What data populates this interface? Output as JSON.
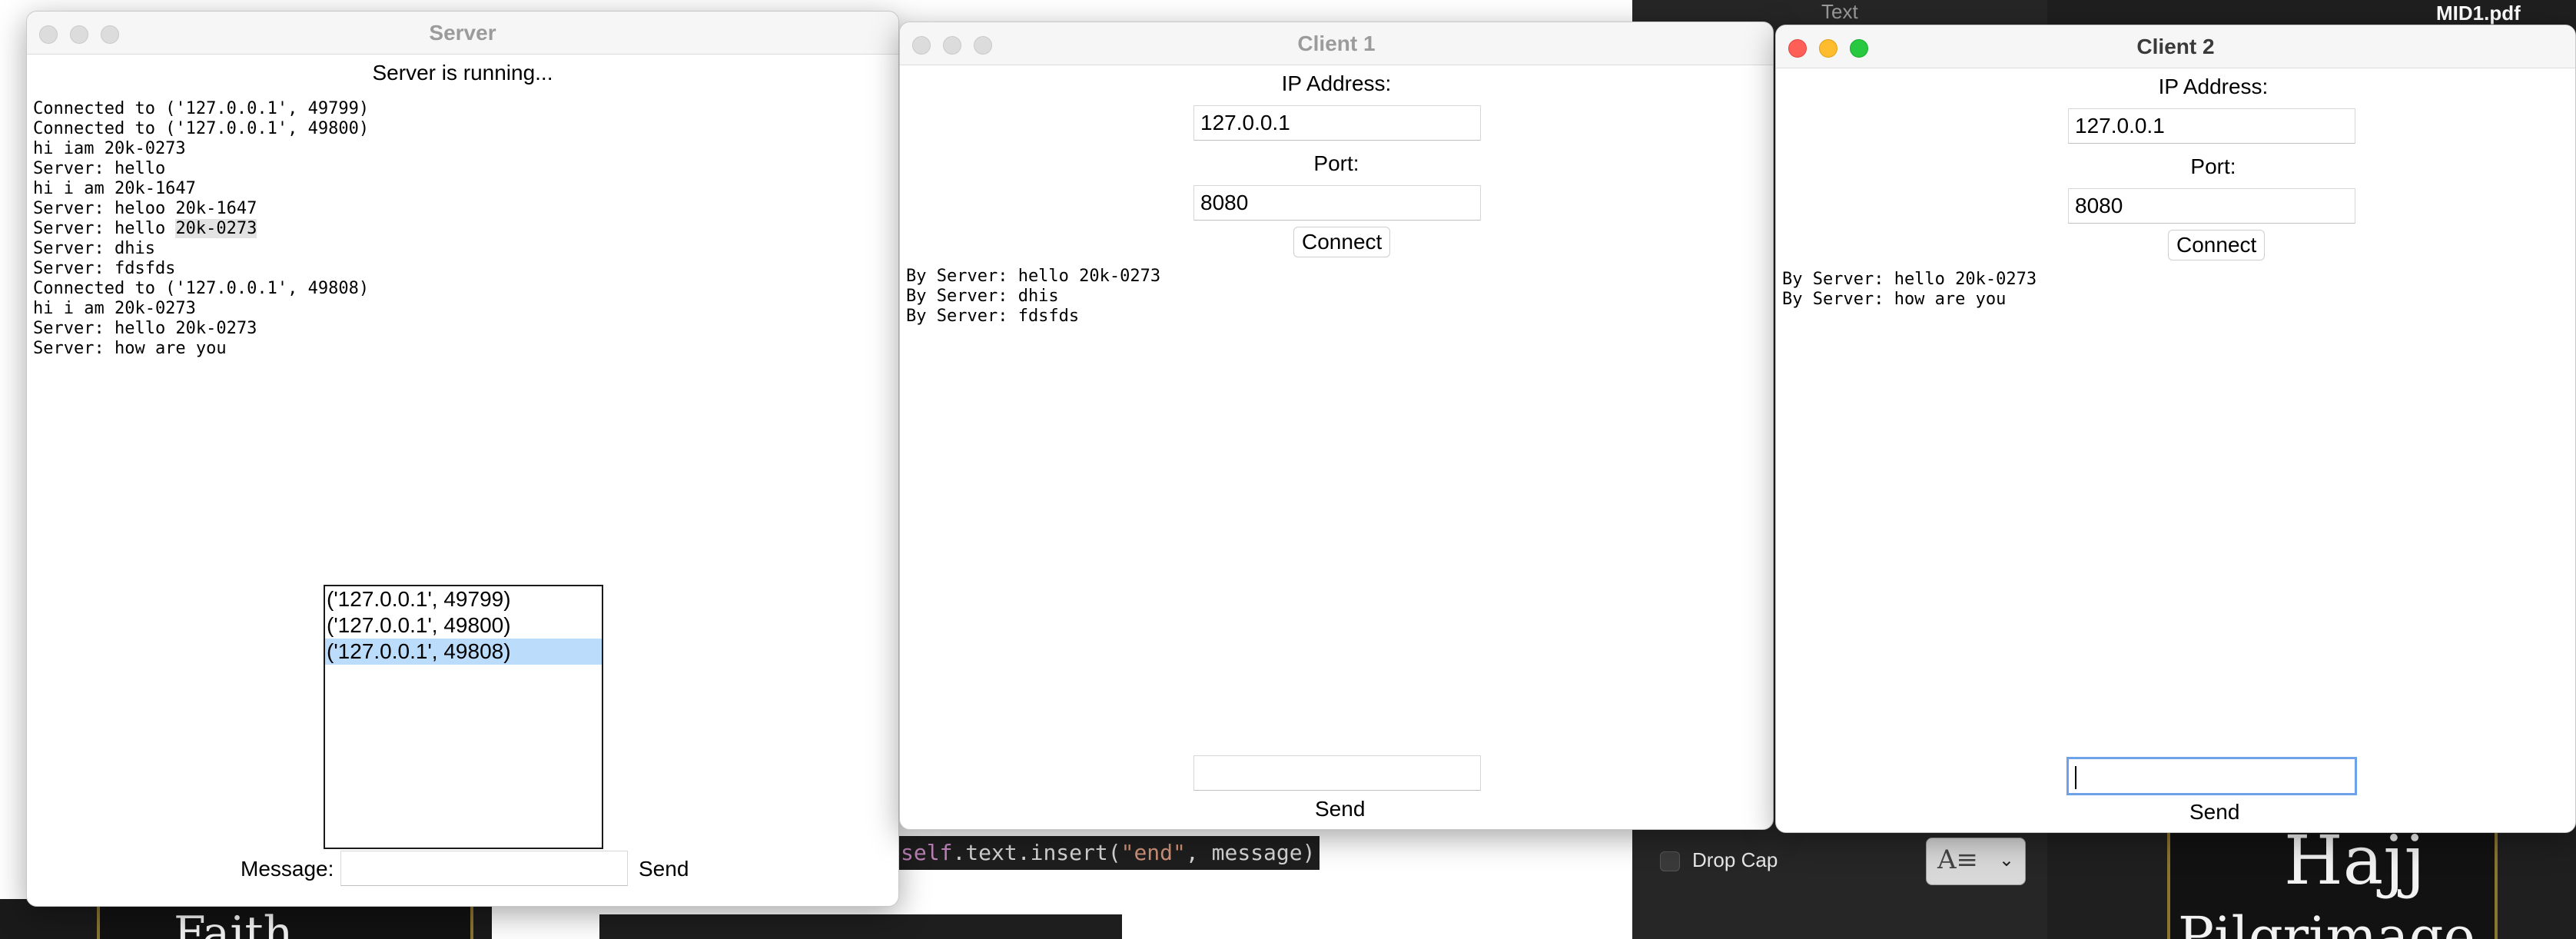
{
  "background": {
    "code_line": {
      "kw": "self",
      "mid": ".text.insert(",
      "str": "\"end\"",
      "end": ", message)"
    },
    "pages_header_text": "Text",
    "pdf_title": "MID1.pdf",
    "drop_cap_label": "Drop Cap",
    "book_left_text": "Faith",
    "book_right_line1": "Hajj",
    "book_right_line2": "Pilgrimage"
  },
  "server": {
    "title": "Server",
    "status": "Server is running...",
    "log": [
      "Connected to ('127.0.0.1', 49799)",
      "Connected to ('127.0.0.1', 49800)",
      "hi iam 20k-0273",
      "Server: hello",
      "hi i am 20k-1647",
      "Server: heloo 20k-1647",
      "Server: hello 20k-0273",
      "Server: dhis",
      "Server: fdsfds",
      "Connected to ('127.0.0.1', 49808)",
      "hi i am 20k-0273",
      "Server: hello 20k-0273",
      "Server: how are you"
    ],
    "clients": [
      "('127.0.0.1', 49799)",
      "('127.0.0.1', 49800)",
      "('127.0.0.1', 49808)"
    ],
    "selected_client_index": 2,
    "message_label": "Message:",
    "message_value": "",
    "send_label": "Send"
  },
  "client1": {
    "title": "Client 1",
    "ip_label": "IP Address:",
    "ip_value": "127.0.0.1",
    "port_label": "Port:",
    "port_value": "8080",
    "connect_label": "Connect",
    "log": [
      "By Server: hello 20k-0273",
      "By Server: dhis",
      "By Server: fdsfds"
    ],
    "message_value": "",
    "send_label": "Send"
  },
  "client2": {
    "title": "Client 2",
    "ip_label": "IP Address:",
    "ip_value": "127.0.0.1",
    "port_label": "Port:",
    "port_value": "8080",
    "connect_label": "Connect",
    "log": [
      "By Server: hello 20k-0273",
      "By Server: how are you"
    ],
    "message_value": "",
    "send_label": "Send"
  }
}
